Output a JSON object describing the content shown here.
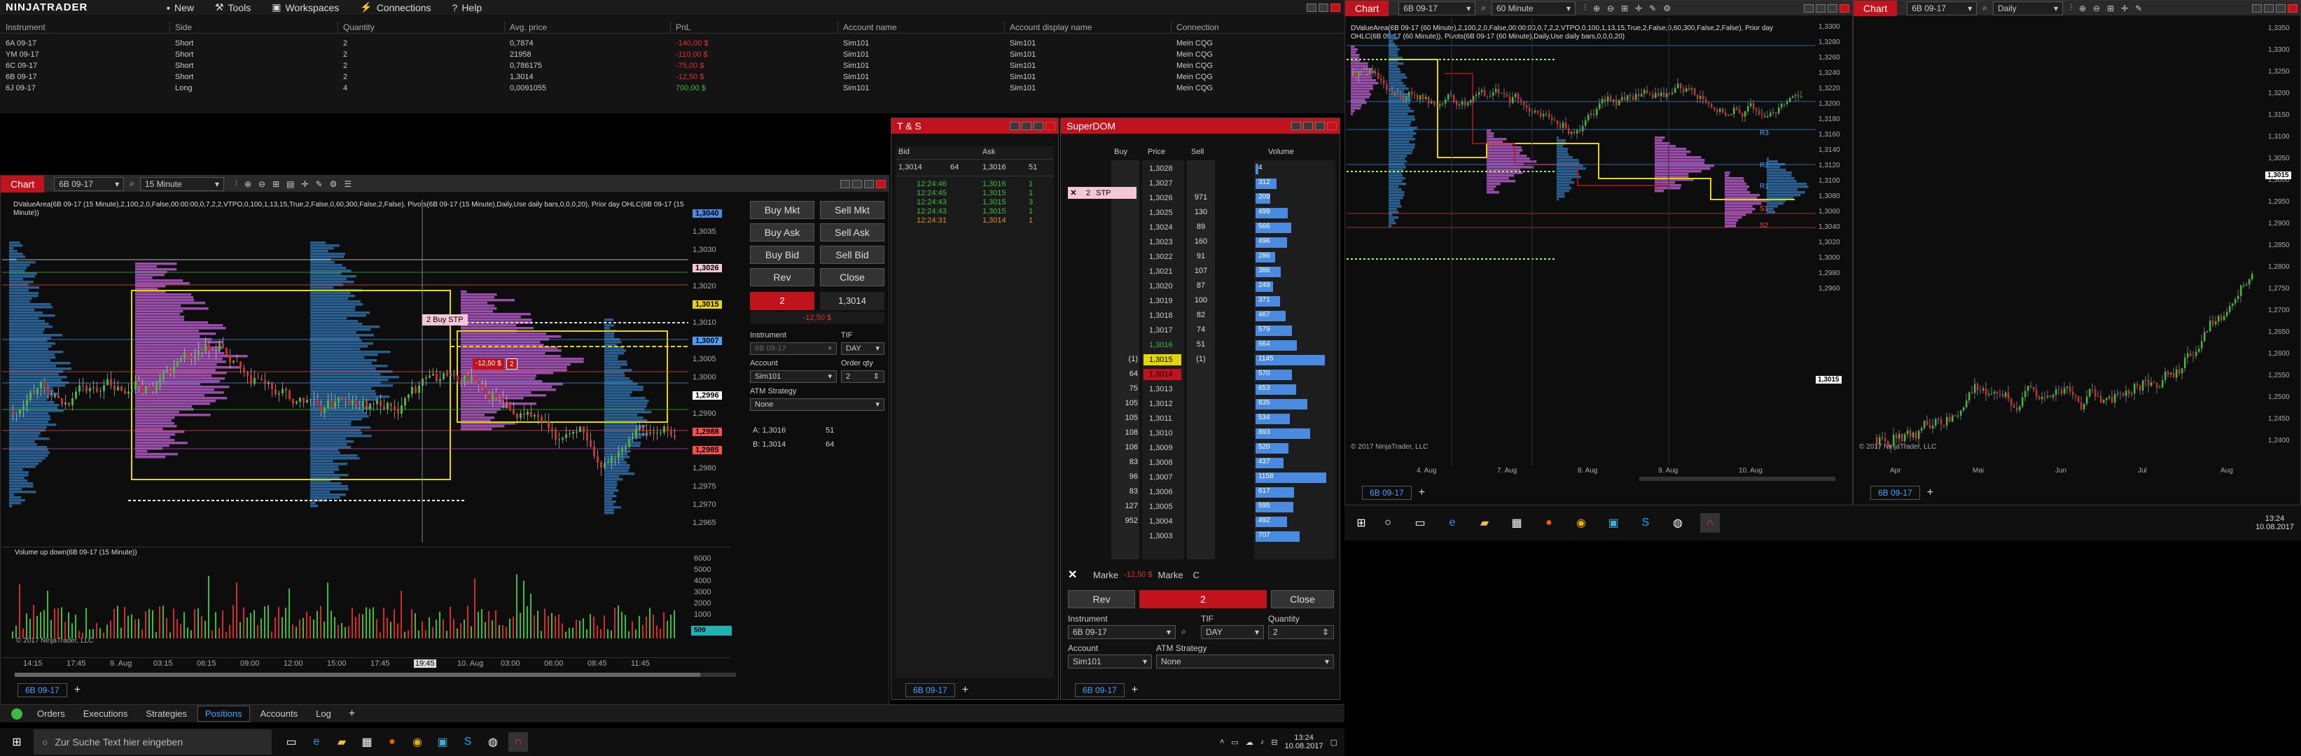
{
  "menu": {
    "logo": "NINJATRADER",
    "items": [
      "New",
      "Tools",
      "Workspaces",
      "Connections",
      "Help"
    ]
  },
  "positions": {
    "headers": [
      "Instrument",
      "Side",
      "Quantity",
      "Avg. price",
      "PnL",
      "Account name",
      "Account display name",
      "Connection"
    ],
    "rows": [
      [
        "6A 09-17",
        "Short",
        "2",
        "0,7874",
        "-140,00 $",
        "Sim101",
        "Sim101",
        "Mein CQG"
      ],
      [
        "YM 09-17",
        "Short",
        "2",
        "21958",
        "-110,00 $",
        "Sim101",
        "Sim101",
        "Mein CQG"
      ],
      [
        "6C 09-17",
        "Short",
        "2",
        "0,786175",
        "-75,00 $",
        "Sim101",
        "Sim101",
        "Mein CQG"
      ],
      [
        "6B 09-17",
        "Short",
        "2",
        "1,3014",
        "-12,50 $",
        "Sim101",
        "Sim101",
        "Mein CQG"
      ],
      [
        "6J 09-17",
        "Long",
        "4",
        "0,0091055",
        "700,00 $",
        "Sim101",
        "Sim101",
        "Mein CQG"
      ]
    ],
    "tabs": [
      "Orders",
      "Executions",
      "Strategies",
      "Positions",
      "Accounts",
      "Log"
    ],
    "active_tab": "Positions"
  },
  "chart1": {
    "tab": "Chart",
    "instrument": "6B 09-17",
    "interval": "15 Minute",
    "header": "DValueArea(6B 09-17 (15 Minute),2,100,2,0,False,00:00:00,0,7,2,2,VTPO,0,100,1,13,15,True,2,False,0,60,300,False,2,False), Pivots(6B 09-17 (15 Minute),Daily,Use daily bars,0,0,0,20), Prior day OHLC(6B 09-17 (15 Minute))",
    "order_label": "2  Buy STP",
    "pnl_tag": "-12,50 $",
    "pnl_qty": "2",
    "price_labels": [
      "1,3040",
      "1,3035",
      "1,3030",
      "1,3026",
      "1,3020",
      "1,3015",
      "1,3010",
      "1,3007",
      "1,3005",
      "1,3000",
      "1,2996",
      "1,2990",
      "1,2988",
      "1,2985",
      "1,2980",
      "1,2975",
      "1,2970",
      "1,2965"
    ],
    "time_labels": [
      "14:15",
      "17:45",
      "9. Aug",
      "03:15",
      "06:15",
      "09:00",
      "12:00",
      "15:00",
      "17:45",
      "19:45",
      "10. Aug",
      "03:00",
      "06:00",
      "08:45",
      "11:45"
    ],
    "volume_title": "Volume up down(6B 09-17 (15 Minute))",
    "volume_labels": [
      "6000",
      "5000",
      "4000",
      "3000",
      "2000",
      "1000"
    ],
    "volume_value": "509",
    "copyright": "© 2017 NinjaTrader, LLC",
    "bottom_tab": "6B 09-17"
  },
  "chart_trader": {
    "buttons": [
      "Buy Mkt",
      "Sell Mkt",
      "Buy Ask",
      "Sell Ask",
      "Buy Bid",
      "Sell Bid",
      "Rev",
      "Close"
    ],
    "position_qty": "2",
    "position_price": "1,3014",
    "position_pnl": "-12,50 $",
    "instrument_lbl": "Instrument",
    "instrument": "6B 09-17",
    "tif_lbl": "TIF",
    "tif": "DAY",
    "account_lbl": "Account",
    "account": "Sim101",
    "orderqty_lbl": "Order qty",
    "orderqty": "2",
    "atm_lbl": "ATM Strategy",
    "atm": "None",
    "ask": "A:  1,3016",
    "ask_size": "51",
    "bid": "B:  1,3014",
    "bid_size": "64"
  },
  "ts": {
    "title": "T & S",
    "headers": [
      "Bid",
      "Ask"
    ],
    "inside": [
      "1,3014",
      "64",
      "1,3016",
      "51"
    ],
    "rows": [
      [
        "12:24:46",
        "1,3016",
        "1",
        "green"
      ],
      [
        "12:24:45",
        "1,3015",
        "1",
        "green"
      ],
      [
        "12:24:43",
        "1,3015",
        "3",
        "green"
      ],
      [
        "12:24:43",
        "1,3015",
        "1",
        "green"
      ],
      [
        "12:24:31",
        "1,3014",
        "1",
        "orange"
      ]
    ],
    "bottom_tab": "6B 09-17"
  },
  "superdom": {
    "title": "SuperDOM",
    "headers": [
      "Buy",
      "Price",
      "Sell",
      "Volume"
    ],
    "order": {
      "qty": "2",
      "type": "STP",
      "price_row": 2
    },
    "rows": [
      {
        "buy": "",
        "price": "1,3028",
        "sell": "",
        "vol": "4"
      },
      {
        "buy": "",
        "price": "1,3027",
        "sell": "",
        "vol": "312"
      },
      {
        "buy": "",
        "price": "1,3026",
        "sell": "971",
        "vol": "209"
      },
      {
        "buy": "",
        "price": "1,3025",
        "sell": "130",
        "vol": "499"
      },
      {
        "buy": "",
        "price": "1,3024",
        "sell": "89",
        "vol": "566"
      },
      {
        "buy": "",
        "price": "1,3023",
        "sell": "160",
        "vol": "496"
      },
      {
        "buy": "",
        "price": "1,3022",
        "sell": "91",
        "vol": "286"
      },
      {
        "buy": "",
        "price": "1,3021",
        "sell": "107",
        "vol": "386"
      },
      {
        "buy": "",
        "price": "1,3020",
        "sell": "87",
        "vol": "249"
      },
      {
        "buy": "",
        "price": "1,3019",
        "sell": "100",
        "vol": "371"
      },
      {
        "buy": "",
        "price": "1,3018",
        "sell": "82",
        "vol": "467"
      },
      {
        "buy": "",
        "price": "1,3017",
        "sell": "74",
        "vol": "579"
      },
      {
        "buy": "",
        "price": "1,3016",
        "sell": "51",
        "vol": "664"
      },
      {
        "buy": "(1)",
        "price": "1,3015",
        "sell": "(1)",
        "vol": "1145"
      },
      {
        "buy": "64",
        "price": "1,3014",
        "sell": "",
        "vol": "570"
      },
      {
        "buy": "75",
        "price": "1,3013",
        "sell": "",
        "vol": "653"
      },
      {
        "buy": "105",
        "price": "1,3012",
        "sell": "",
        "vol": "835"
      },
      {
        "buy": "105",
        "price": "1,3011",
        "sell": "",
        "vol": "534"
      },
      {
        "buy": "108",
        "price": "1,3010",
        "sell": "",
        "vol": "893"
      },
      {
        "buy": "106",
        "price": "1,3009",
        "sell": "",
        "vol": "520"
      },
      {
        "buy": "83",
        "price": "1,3008",
        "sell": "",
        "vol": "437"
      },
      {
        "buy": "96",
        "price": "1,3007",
        "sell": "",
        "vol": "1158"
      },
      {
        "buy": "83",
        "price": "1,3006",
        "sell": "",
        "vol": "617"
      },
      {
        "buy": "127",
        "price": "1,3005",
        "sell": "",
        "vol": "595"
      },
      {
        "buy": "952",
        "price": "1,3004",
        "sell": "",
        "vol": "492"
      },
      {
        "buy": "",
        "price": "1,3003",
        "sell": "",
        "vol": "707"
      }
    ],
    "marke_buy": "Marke",
    "marke_pnl": "-12,50 $",
    "marke_sell": "Marke",
    "marke_c": "C",
    "rev": "Rev",
    "qty": "2",
    "close": "Close",
    "instrument_lbl": "Instrument",
    "instrument": "6B 09-17",
    "tif_lbl": "TIF",
    "tif": "DAY",
    "qty_lbl": "Quantity",
    "quantity": "2",
    "account_lbl": "Account",
    "account": "Sim101",
    "atm_lbl": "ATM Strategy",
    "atm": "None",
    "bottom_tab": "6B 09-17"
  },
  "chart2": {
    "tab": "Chart",
    "instrument": "6B 09-17",
    "interval": "60 Minute",
    "header": "DValueArea(6B 09-17 (60 Minute),2,100,2,0,False,00:00:00,0,7,2,2,VTPO,0,100,1,13,15,True,2,False,0,60,300,False,2,False), Prior day OHLC(6B 09-17 (60 Minute)), Pivots(6B 09-17 (60 Minute),Daily,Use daily bars,0,0,0,20)",
    "price_labels": [
      "1,3300",
      "1,3280",
      "1,3260",
      "1,3240",
      "1,3220",
      "1,3200",
      "1,3180",
      "1,3160",
      "1,3140",
      "1,3120",
      "1,3100",
      "1,3080",
      "1,3060",
      "1,3040",
      "1,3020",
      "1,3000",
      "1,2980",
      "1,2960"
    ],
    "pivot_labels": [
      "R3",
      "R2",
      "R1",
      "S1",
      "S2"
    ],
    "last_price": "1,3015",
    "time_labels": [
      "4. Aug",
      "7. Aug",
      "8. Aug",
      "9. Aug",
      "10. Aug"
    ],
    "copyright": "© 2017 NinjaTrader, LLC",
    "bottom_tab": "6B 09-17"
  },
  "chart3": {
    "tab": "Chart",
    "instrument": "6B 09-17",
    "interval": "Daily",
    "price_labels": [
      "1,3350",
      "1,3300",
      "1,3250",
      "1,3200",
      "1,3150",
      "1,3100",
      "1,3050",
      "1,3000",
      "1,2950",
      "1,2900",
      "1,2850",
      "1,2800",
      "1,2750",
      "1,2700",
      "1,2650",
      "1,2600",
      "1,2550",
      "1,2500",
      "1,2450",
      "1,2400"
    ],
    "last_price": "1,3015",
    "time_labels": [
      "Apr",
      "Mai",
      "Jun",
      "Jul",
      "Aug"
    ],
    "copyright": "© 2017 NinjaTrader, LLC",
    "bottom_tab": "6B 09-17"
  },
  "taskbar": {
    "search": "Zur Suche Text hier eingeben",
    "time": "13:24",
    "date": "10.08.2017"
  },
  "taskbar2": {
    "time": "13:24",
    "date": "10.08.2017"
  },
  "colors": {
    "accent": "#c0131e",
    "profile_blue": "#2f6fa7",
    "profile_pink": "#b25bc4",
    "green": "#3dbb3d",
    "red": "#d42b2b",
    "yellow": "#e6d600"
  }
}
